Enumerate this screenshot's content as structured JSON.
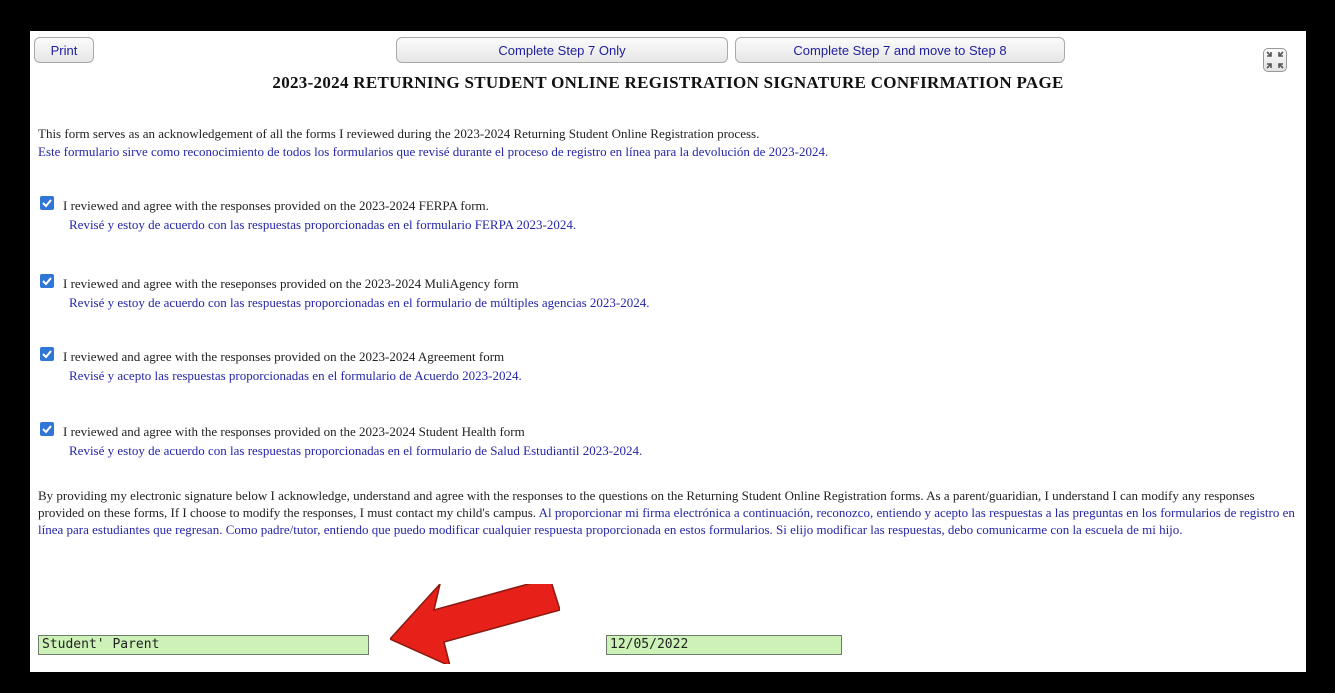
{
  "toolbar": {
    "print_label": "Print",
    "step7_label": "Complete Step 7 Only",
    "step7_8_label": "Complete Step 7 and move to Step 8"
  },
  "page_title": "2023-2024 RETURNING STUDENT ONLINE REGISTRATION SIGNATURE CONFIRMATION PAGE",
  "intro": {
    "en": "This form serves as an acknowledgement of all the forms I reviewed during the 2023-2024 Returning Student Online Registration process.",
    "es": "Este formulario sirve como reconocimiento de todos los formularios que revisé durante el proceso de registro en línea para la devolución de 2023-2024."
  },
  "items": [
    {
      "checked": true,
      "en": "I reviewed and agree with the responses provided on the 2023-2024 FERPA form.",
      "es": "Revisé y estoy de acuerdo con las respuestas proporcionadas en el formulario FERPA 2023-2024."
    },
    {
      "checked": true,
      "en": "I reviewed and agree with the reseponses provided on the 2023-2024 MuliAgency form",
      "es": "Revisé y estoy de acuerdo con las respuestas proporcionadas en el formulario de múltiples agencias 2023-2024."
    },
    {
      "checked": true,
      "en": "I reviewed and agree with the responses provided on the 2023-2024 Agreement form",
      "es": "Revisé y acepto las respuestas proporcionadas en el formulario de Acuerdo 2023-2024."
    },
    {
      "checked": true,
      "en": "I reviewed and agree with the responses provided on the 2023-2024 Student Health form",
      "es": "Revisé y estoy de acuerdo con las respuestas proporcionadas en el formulario de Salud Estudiantil 2023-2024."
    }
  ],
  "signature_text": {
    "en": "By providing my electronic signature below I acknowledge, understand and agree with the responses to the questions on the Returning Student Online Registration forms. As a parent/guaridian, I understand I can modify any responses provided on these forms, If I choose to modify the responses, I must contact my child's campus.",
    "es": "Al proporcionar mi firma electrónica a continuación, reconozco, entiendo y acepto las respuestas a las preguntas en los formularios de registro en línea para estudiantes que regresan. Como padre/tutor, entiendo que puedo modificar cualquier respuesta proporcionada en estos formularios. Si elijo modificar las respuestas, debo comunicarme con la escuela de mi hijo."
  },
  "signature_field": {
    "value": "Student' Parent"
  },
  "date_field": {
    "value": "12/05/2022"
  },
  "colors": {
    "field_bg": "#ccf2b8",
    "checkbox": "#2f76d6",
    "spanish_text": "#2626a8",
    "arrow": "#e8201a"
  },
  "icons": {
    "expand": "expand-icon",
    "checkbox": "checkbox-checked-icon",
    "arrow": "red-arrow-annotation"
  }
}
